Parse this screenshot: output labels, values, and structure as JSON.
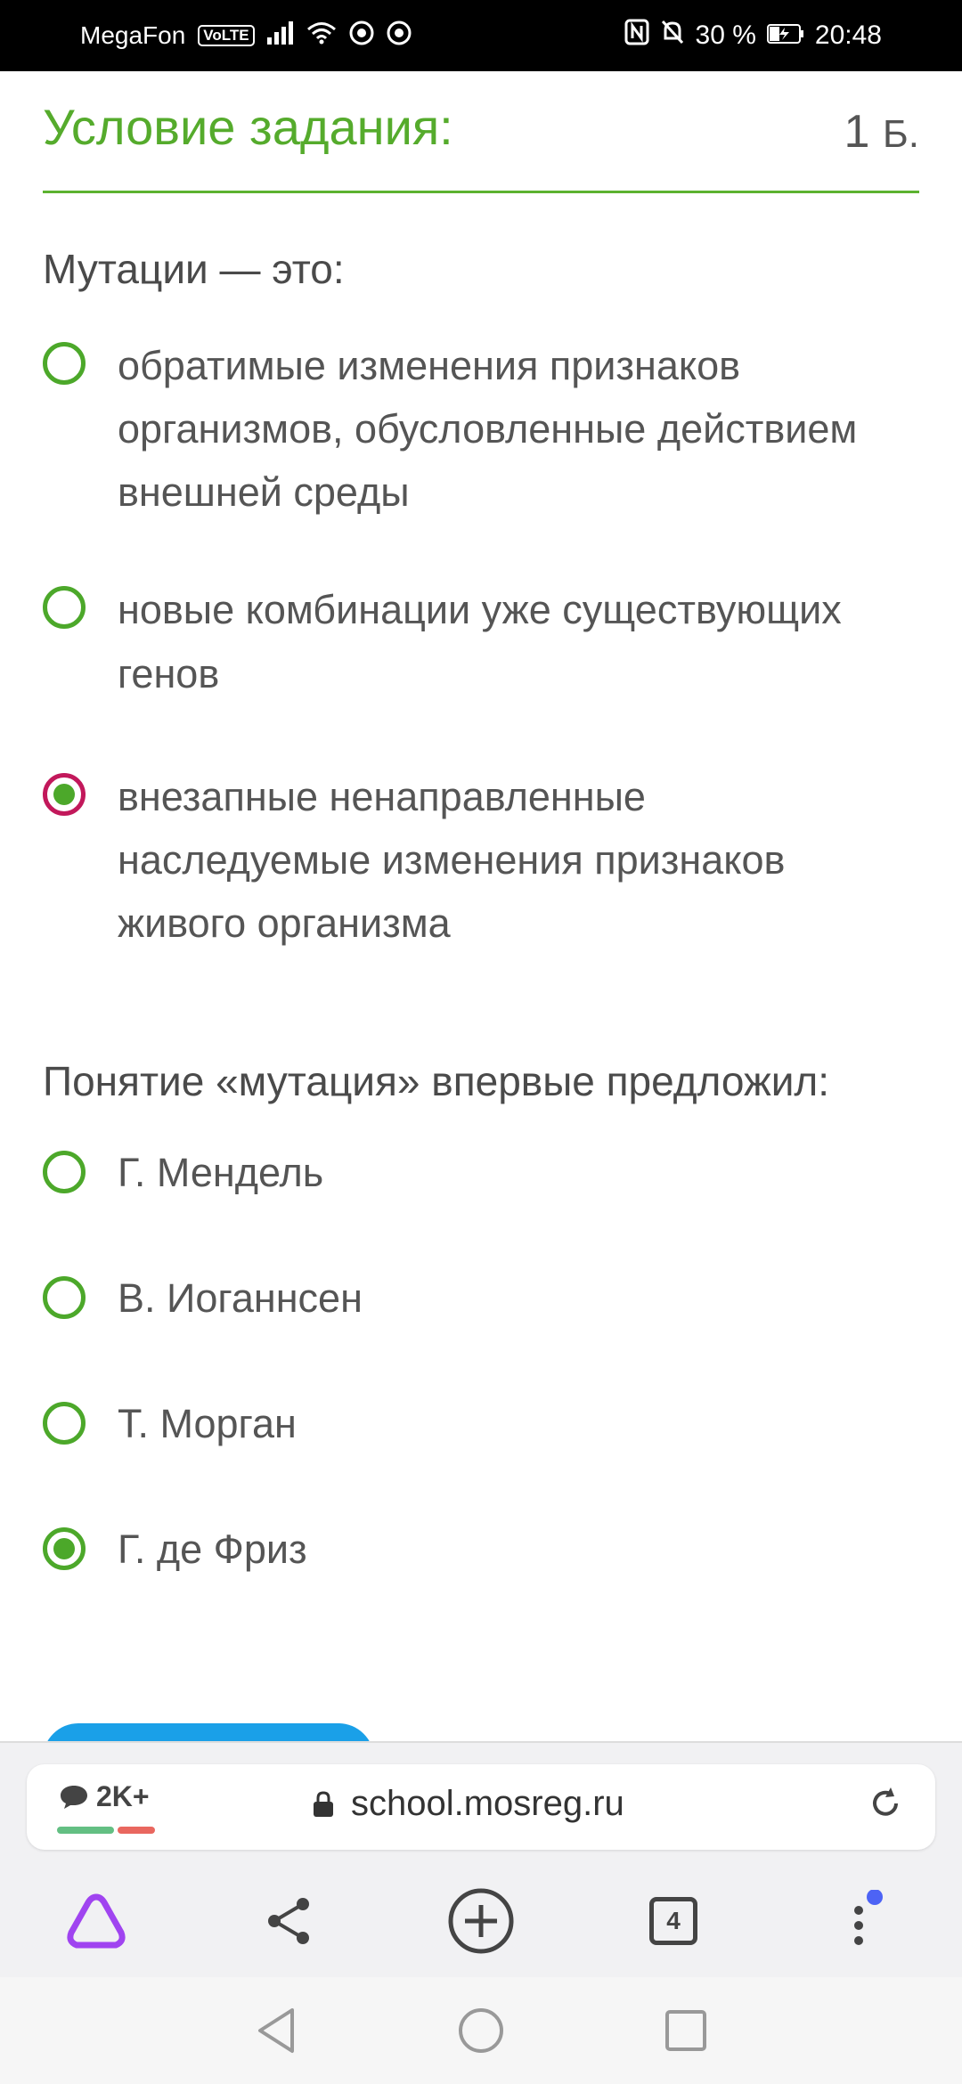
{
  "status": {
    "carrier": "MegaFon",
    "volte": "VoLTE",
    "battery": "30 %",
    "time": "20:48"
  },
  "header": {
    "title": "Условие задания:",
    "points_value": "1",
    "points_unit": "Б."
  },
  "questions": [
    {
      "text": "Мутации — это:",
      "options": [
        {
          "label": "обратимые изменения признаков организмов, обусловленные действием внешней среды",
          "selected": false
        },
        {
          "label": "новые комбинации уже существующих генов",
          "selected": false
        },
        {
          "label": "внезапные ненаправленные наследуемые изменения признаков живого организма",
          "selected": true
        }
      ]
    },
    {
      "text": "Понятие «мутация» впервые предложил:",
      "options": [
        {
          "label": "Г. Мендель",
          "selected": false
        },
        {
          "label": "В. Иоганнсен",
          "selected": false
        },
        {
          "label": "Т. Морган",
          "selected": false
        },
        {
          "label": "Г. де Фриз",
          "selected": true
        }
      ]
    }
  ],
  "browser": {
    "comments_count": "2K+",
    "url": "school.mosreg.ru",
    "tabs_count": "4"
  },
  "colors": {
    "accent_green": "#55ab2c",
    "radio_green": "#4ca82a",
    "focus_ring": "#c2185b",
    "button_blue": "#1aa0e8"
  }
}
